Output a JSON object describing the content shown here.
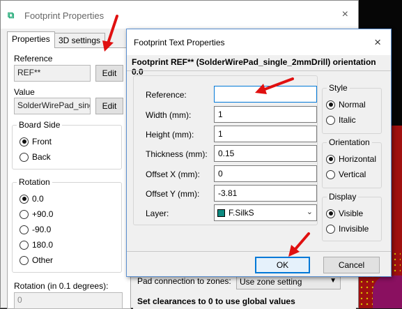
{
  "background": {
    "colors": {
      "canvas": "#060606",
      "copper_red": "#a01010",
      "pad_magenta": "#8a1060",
      "dots": "#d8c800"
    }
  },
  "footprint_window": {
    "title": "Footprint Properties",
    "close_icon": "×",
    "tabs": [
      "Properties",
      "3D settings"
    ],
    "reference_label": "Reference",
    "reference_value": "REF**",
    "reference_edit": "Edit",
    "value_label": "Value",
    "value_value": "SolderWirePad_sing",
    "value_edit": "Edit",
    "board_side": {
      "title": "Board Side",
      "options": [
        "Front",
        "Back"
      ],
      "selected": "Front"
    },
    "rotation": {
      "title": "Rotation",
      "options": [
        "0.0",
        "+90.0",
        "-90.0",
        "180.0",
        "Other"
      ],
      "selected": "0.0"
    },
    "rotation_deg_label": "Rotation (in 0.1 degrees):",
    "rotation_deg_value": "0",
    "pad_connection_label": "Pad connection to zones:",
    "pad_connection_value": "Use zone setting",
    "clearance_note": "Set clearances to 0 to use global values"
  },
  "text_dialog": {
    "title": "Footprint Text Properties",
    "close_icon": "×",
    "header": "Footprint REF** (SolderWirePad_single_2mmDrill) orientation 0.0",
    "fields": {
      "reference": {
        "label": "Reference:",
        "value": ""
      },
      "width": {
        "label": "Width (mm):",
        "value": "1"
      },
      "height": {
        "label": "Height (mm):",
        "value": "1"
      },
      "thickness": {
        "label": "Thickness (mm):",
        "value": "0.15"
      },
      "offset_x": {
        "label": "Offset X (mm):",
        "value": "0"
      },
      "offset_y": {
        "label": "Offset Y (mm):",
        "value": "-3.81"
      },
      "layer": {
        "label": "Layer:",
        "value": "F.SilkS",
        "swatch_color": "#0c8a80"
      }
    },
    "style": {
      "title": "Style",
      "options": [
        "Normal",
        "Italic"
      ],
      "selected": "Normal"
    },
    "orientation": {
      "title": "Orientation",
      "options": [
        "Horizontal",
        "Vertical"
      ],
      "selected": "Horizontal"
    },
    "display": {
      "title": "Display",
      "options": [
        "Visible",
        "Invisible"
      ],
      "selected": "Visible"
    },
    "ok_label": "OK",
    "cancel_label": "Cancel"
  },
  "annotation_arrows": {
    "color": "#e01010"
  }
}
